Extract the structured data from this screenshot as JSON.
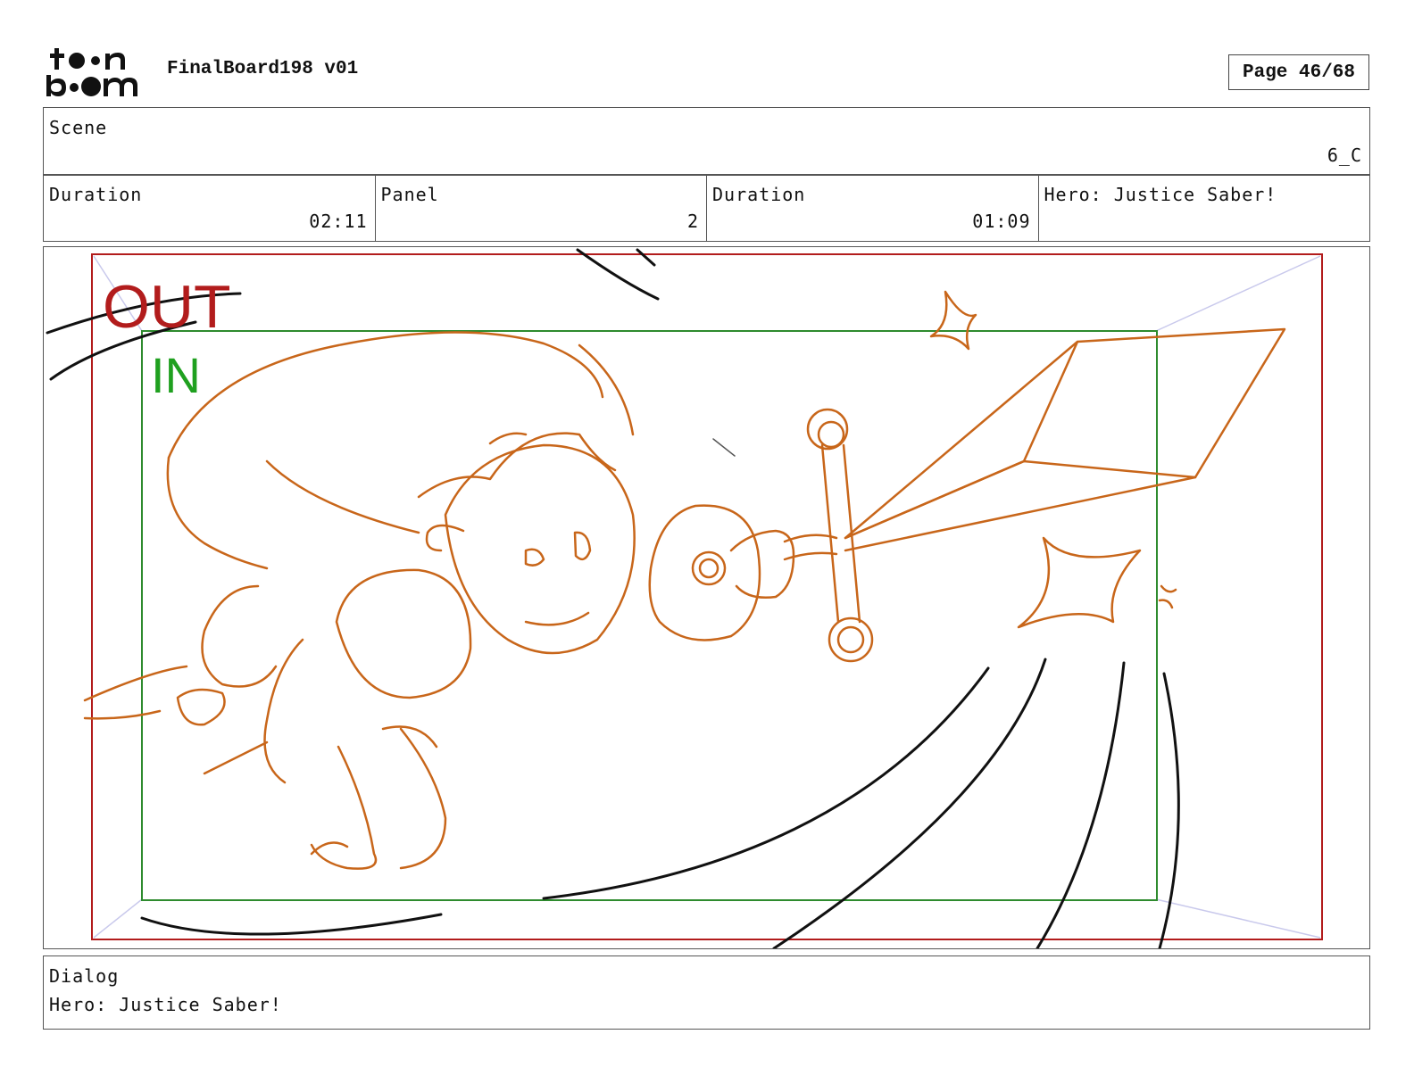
{
  "header": {
    "title": "FinalBoard198 v01",
    "page_label": "Page 46/68"
  },
  "scene": {
    "label": "Scene",
    "value": "6_C"
  },
  "info": {
    "scene_duration_label": "Duration",
    "scene_duration_value": "02:11",
    "panel_label": "Panel",
    "panel_value": "2",
    "panel_duration_label": "Duration",
    "panel_duration_value": "01:09",
    "dialog_preview": "Hero: Justice Saber!"
  },
  "frame": {
    "out_label": "OUT",
    "in_label": "IN",
    "out_color": "#b21c1c",
    "in_color": "#1fa01f",
    "sketch_color": "#c8661a"
  },
  "dialog": {
    "label": "Dialog",
    "text": "Hero: Justice Saber!"
  }
}
